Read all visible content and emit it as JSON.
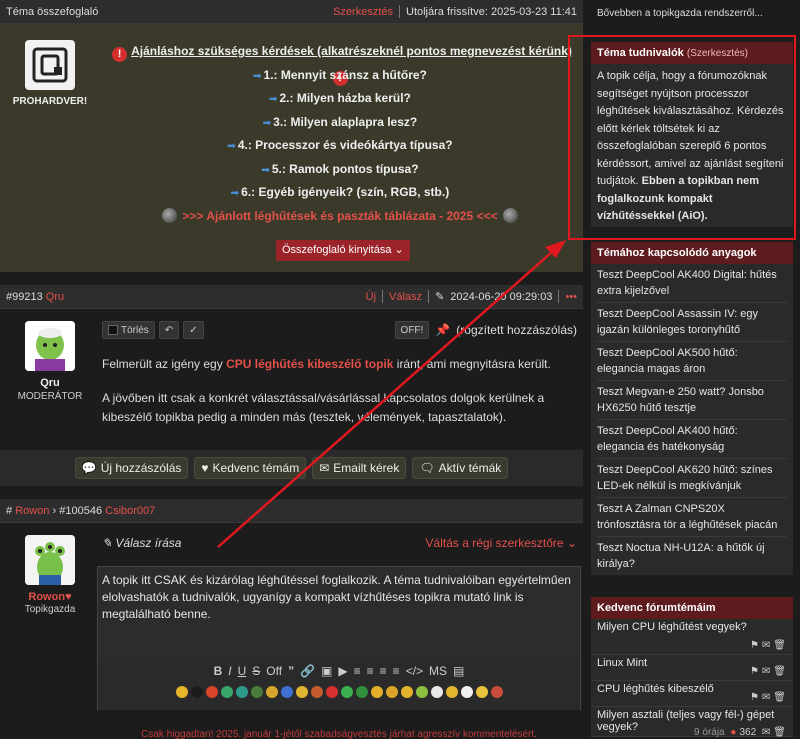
{
  "summary_header": {
    "title": "Téma összefoglaló",
    "edit": "Szerkesztés",
    "updated": "Utoljára frissítve: 2025-03-23 11:41"
  },
  "summary": {
    "logo_label": "PROHARDVER!",
    "heading": "Ajánláshoz szükséges kérdések (alkatrészeknél pontos megnevezést kérünk)",
    "questions": [
      "1.: Mennyit szánsz a hűtőre?",
      "2.: Milyen házba kerül?",
      "3.: Milyen alaplapra lesz?",
      "4.: Processzor és videókártya típusa?",
      "5.: Ramok pontos típusa?",
      "6.: Egyéb igényeik? (szín, RGB, stb.)"
    ],
    "table_link": ">>> Ajánlott léghűtések és paszták táblázata - 2025 <<<",
    "expand_button": "Összefoglaló kinyitása"
  },
  "post1": {
    "number": "#99213",
    "author": "Qru",
    "new": "Új",
    "reply": "Válasz",
    "date": "2024-06-20 09:29:03",
    "more": "•••",
    "role": "MODERÁTOR",
    "delete_label": "Törlés",
    "off_label": "OFF!",
    "pinned": "(rögzített hozzászólás)",
    "text1_pre": "Felmerült az igény egy ",
    "text1_link": "CPU léghűtés kibeszélő topik",
    "text1_post": " iránt, ami megnyitásra került.",
    "text2": "A jövőben itt csak a konkrét választással/vásárlással kapcsolatos dolgok kerülnek a kibeszélő topikba pedig a minden más (tesztek, vélemények, tapasztalatok)."
  },
  "actions": {
    "new_post": "Új hozzászólás",
    "favorite": "Kedvenc témám",
    "email": "Emailt kérek",
    "active": "Aktív témák"
  },
  "post2": {
    "hash": "#",
    "author_from": "Rowon",
    "ref": "#100546",
    "author_to": "Csibor007",
    "reply_writing": "Válasz írása",
    "switch_editor": "Váltás a régi szerkesztőre",
    "user": "Rowon",
    "role": "Topikgazda",
    "editor_text": "A topik itt CSAK és kizárólag léghűtéssel foglalkozik. A téma tudnivalóiban egyértelműen elolvashatók a tudnivalók, ugyanígy a kompakt vízhűtéses topikra mutató link is megtalálható benne.",
    "toolbar": [
      "B",
      "I",
      "U",
      "S",
      "Off",
      "”",
      "🔗",
      "▣",
      "▶",
      "≡",
      "≡",
      "≡",
      "≡",
      "</>",
      "MS",
      "▤"
    ],
    "footer_note": "Csak higgadtan! 2025. január 1-jétől szabadságvesztés járhat agresszív kommentelésért."
  },
  "sidebar": {
    "more_link": "Bővebben a topikgazda rendszerről...",
    "notes_title": "Téma tudnivalók",
    "notes_edit": "(Szerkesztés)",
    "notes_text": "A topik célja, hogy a fórumozóknak segítséget nyújtson processzor léghűtések kiválasztásához. Kérdezés előtt kérlek töltsétek ki az összefoglalóban szereplő 6 pontos kérdéssort, amivel az ajánlást segíteni tudjátok.",
    "notes_bold": "Ebben a topikban nem foglalkozunk kompakt vízhűtéssekkel (AiO).",
    "related_title": "Témához kapcsolódó anyagok",
    "related": [
      "Teszt DeepCool AK400 Digital: hűtés extra kijelzővel",
      "Teszt DeepCool Assassin IV: egy igazán különleges toronyhűtő",
      "Teszt DeepCool AK500 hűtő: elegancia magas áron",
      "Teszt Megvan-e 250 watt? Jonsbo HX6250 hűtő tesztje",
      "Teszt DeepCool AK400 hűtő: elegancia és hatékonyság",
      "Teszt DeepCool AK620 hűtő: színes LED-ek nélkül is megkívánjuk",
      "Teszt A Zalman CNPS20X trónfosztásra tör a léghűtések piacán",
      "Teszt Noctua NH-U12A: a hűtők új királya?"
    ],
    "fav_title": "Kedvenc fórumtémáim",
    "favs": [
      "Milyen CPU léghűtést vegyek?",
      "Linux Mint",
      "CPU léghűtés kibeszélő",
      "Milyen asztali (teljes vagy fél-) gépet vegyek?"
    ],
    "fav_meta": "9 órája",
    "fav_count": "362"
  },
  "colors": {
    "accent": "#e2514a",
    "panel_header": "#5e1b1e",
    "summary_bg": "#3b3a2a",
    "annotation": "#e0181f"
  }
}
